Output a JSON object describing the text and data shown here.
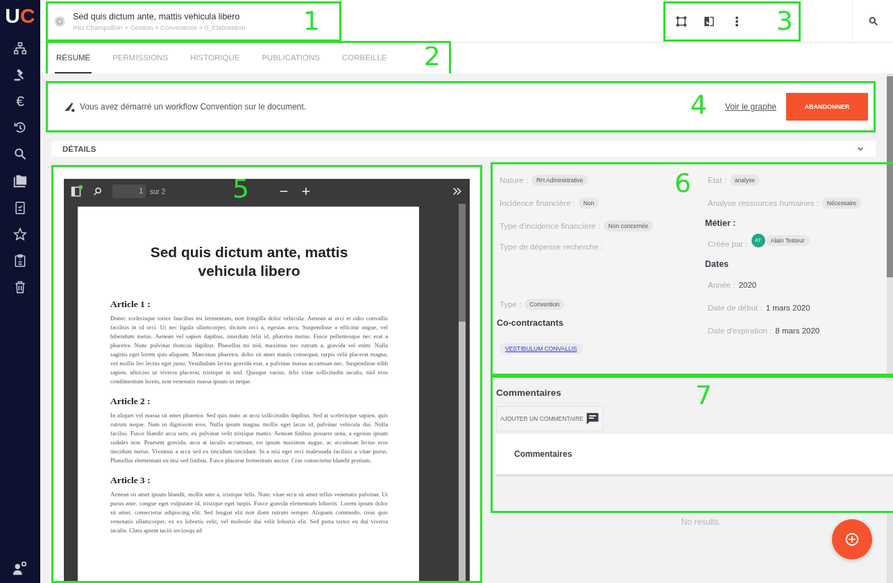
{
  "sidebar": {
    "logo": [
      "U",
      "C"
    ],
    "items": [
      {
        "kind": "sitemap"
      },
      {
        "kind": "gavel"
      },
      {
        "kind": "glyph",
        "glyph": "€"
      },
      {
        "kind": "history"
      },
      {
        "kind": "search"
      },
      {
        "kind": "images"
      },
      {
        "kind": "checklist"
      },
      {
        "kind": "star"
      },
      {
        "kind": "clipboard"
      },
      {
        "kind": "trash"
      }
    ],
    "footer": {
      "kind": "user-settings"
    }
  },
  "header": {
    "annotation": "1",
    "title": "Sed quis dictum ante, mattis vehicula libero",
    "breadcrumb": "INU Champollion > Gestion > Conventions > 0_Élaboration",
    "actions_annotation": "3"
  },
  "tabs": {
    "annotation": "2",
    "items": [
      {
        "label": "RÉSUMÉ",
        "selected": true
      },
      {
        "label": "PERMISSIONS",
        "selected": false
      },
      {
        "label": "HISTORIQUE",
        "selected": false
      },
      {
        "label": "PUBLICATIONS",
        "selected": false
      },
      {
        "label": "CORBEILLE",
        "selected": false
      }
    ]
  },
  "banner": {
    "annotation": "4",
    "message": "Vous avez démarré un workflow Convention sur le document.",
    "link": "Voir le graphe",
    "button": "ABANDONNER"
  },
  "details": {
    "title": "DÉTAILS"
  },
  "viewer": {
    "annotation": "5",
    "page": "1",
    "page_total": "sur 2",
    "document": {
      "title": "Sed quis dictum ante, mattis vehicula libero",
      "articles": [
        {
          "heading": "Article 1 :",
          "text": "Donec scelerisque tortor faucibus mi fermentum, non fringilla dolor vehicula. Aenean at orci et odio convallis facilisis in id orci. Ut nec ligula ullamcorper, dictum orci a, egestas arcu. Suspendisse a efficitur augue, vel bibendum metus. Aenean vel sapien dapibus, interdum felis id, pharetra metus. Fusce pellentesque nec erat a pharetra. Nunc pulvinar rhoncus dapibus. Phasellus mi nisl, maximus nec rutrum a, gravida vel enim. Nulla sagittis eget lorem quis aliquam. Maecenas pharetra, dolor sit amet mattis consequat, turpis velit placerat magna, vel mollis leo lectus eget justo. Vestibulum lectus gravida erat, a pulvinar massa accumsan nec. Suspendisse nibh sapien, ultricies ut viverra placerat, tristique in nisl. Quisque varius, felis vitae sollicitudin iaculis, nisl eros condimentum lorem, non venenatis massa ipsum ut neque."
        },
        {
          "heading": "Article 2 :",
          "text": "In aliquet vel massa sit amet pharetra. Sed quis nunc at arcu sollicitudin dapibus. Sed at scelerisque sapien, quis rutrum neque. Nam in dignissim eros. Nulla ipsum magna, mollis eget lacus id, pulvinar vehicula dui. Nulla facilisi. Fusce blandit arcu sem, eu pulvinar velit tristique mattis. Aenean finibus posuere urna, a egestas ipsum sodales non. Praesent gravida, arcu at iaculis accumsan, est ipsum maximus augue, ac accumsan lectus eros tincidunt metus. Vivamus a arcu sed ex tincidunt tincidunt. In a nisi eget orci malesuada facilisis a vitae purus. Phasellus elementum eu nisi sed finibus. Fusce placerat fermentum auctor. Cras consectetur blandit pretium."
        },
        {
          "heading": "Article 3 :",
          "text": "Aenean sit amet ipsum blandit, mollis ante a, tristique felis. Nunc vitae arcu sit amet tellus venenatis pulvinar. Ut purus ante, congue eget vulputate id, tristique eget turpis. Fusce gravida elementum lobortis. Lorem ipsum dolor sit amet, consectetur adipiscing elit. Sed feugiat elit non diam rutrum semper. Aliquam commodo, risus quis venenatis ullamcorper, ex ex lobortis velit, vel molestie dui velit lobortis elit. Sed porta tortor eu dui viverra iaculis. Class aptent taciti sociosqu ad"
        }
      ]
    }
  },
  "metadata": {
    "annotation": "6",
    "left": [
      {
        "kind": "chip",
        "label": "Nature :",
        "value": "RH Administrative"
      },
      {
        "kind": "chip",
        "label": "Incidence financière :",
        "value": "Non"
      },
      {
        "kind": "chip",
        "label": "Type d'incidence financière :",
        "value": "Non concernée"
      },
      {
        "kind": "empty",
        "label": "Type de dépense recherche :"
      },
      {
        "kind": "chip",
        "label": "Type :",
        "value": "Convention"
      }
    ],
    "co_contractants": {
      "title": "Co-contractants",
      "items": [
        "VESTIBULUM CONVALLIS"
      ]
    },
    "right": [
      {
        "kind": "chip",
        "label": "État :",
        "value": "analyse"
      },
      {
        "kind": "chip",
        "label": "Analyse ressources humaines :",
        "value": "Nécessaire"
      },
      {
        "kind": "heading",
        "label": "Métier :"
      },
      {
        "kind": "user",
        "label": "Créée par :",
        "initials": "AT",
        "value": "Alain Testeur"
      },
      {
        "kind": "heading",
        "label": "Dates"
      },
      {
        "kind": "plain",
        "label": "Année :",
        "value": "2020"
      },
      {
        "kind": "plain",
        "label": "Date de début :",
        "value": "1 mars 2020"
      },
      {
        "kind": "plain",
        "label": "Date d'expiration :",
        "value": "8 mars 2020"
      }
    ]
  },
  "comments": {
    "annotation": "7",
    "title": "Commentaires",
    "add_button": "AJOUTER UN COMMENTAIRE",
    "list_title": "Commentaires",
    "empty": "No results."
  }
}
